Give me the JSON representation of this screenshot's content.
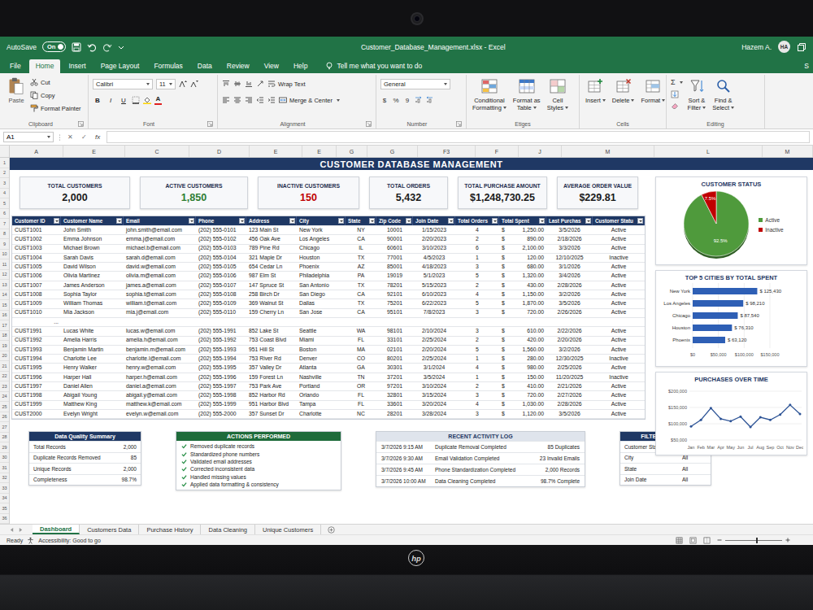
{
  "window": {
    "autosave_label": "AutoSave",
    "autosave": {
      "on": true,
      "text": "On"
    },
    "title": "Customer_Database_Management.xlsx - Excel",
    "user": "Hazem A.",
    "initials": "HA"
  },
  "ribbon_tabs": [
    {
      "label": "File",
      "selected": false
    },
    {
      "label": "Home",
      "selected": true
    },
    {
      "label": "Insert",
      "selected": false
    },
    {
      "label": "Page Layout",
      "selected": false
    },
    {
      "label": "Formulas",
      "selected": false
    },
    {
      "label": "Data",
      "selected": false
    },
    {
      "label": "Review",
      "selected": false
    },
    {
      "label": "View",
      "selected": false
    },
    {
      "label": "Help",
      "selected": false
    }
  ],
  "tell_me": "Tell me what you want to do",
  "share": "S",
  "ribbon": {
    "clipboard": {
      "label": "Clipboard",
      "paste": "Paste",
      "items": [
        "Cut",
        "Copy",
        "Format Painter"
      ]
    },
    "font": {
      "label": "Font",
      "family": "Calibri",
      "size": "11",
      "styles": [
        "B",
        "I",
        "U"
      ],
      "color_glyph": "A"
    },
    "alignment": {
      "label": "Alignment",
      "wrap": "Wrap Text",
      "merge": "Merge & Center"
    },
    "number": {
      "label": "Number",
      "format": "General",
      "symbols": [
        "$",
        "%",
        "9"
      ]
    },
    "styles": {
      "label": "Etiges",
      "buttons": [
        {
          "lines": [
            "Conditional",
            "Formatting"
          ]
        },
        {
          "lines": [
            "Format as",
            "Table"
          ]
        },
        {
          "lines": [
            "Cell",
            "Styles"
          ]
        }
      ]
    },
    "cells": {
      "label": "Cells",
      "buttons": [
        "Insert",
        "Delete",
        "Format"
      ]
    },
    "editing": {
      "label": "Editing",
      "autosum": "Σ",
      "buttons": [
        {
          "lines": [
            "Sort &",
            "Filter"
          ]
        },
        {
          "lines": [
            "Find &",
            "Select"
          ]
        }
      ]
    }
  },
  "formula_bar": {
    "name_box": "A1",
    "cancel": "✕",
    "enter": "✓",
    "fx": "fx"
  },
  "sheet": {
    "columns": [
      "A",
      "E",
      "C",
      "D",
      "E",
      "E",
      "G",
      "G",
      "F3",
      "F",
      "J",
      "M",
      "L",
      "M"
    ],
    "row_numbers": [
      "1",
      "2",
      "3",
      "4",
      "5",
      "6",
      "7",
      "8",
      "9",
      "10",
      "11",
      "12",
      "13",
      "14",
      "15",
      "16",
      "17",
      "18",
      "19",
      "20",
      "21",
      "22",
      "23",
      "24",
      "25",
      "26",
      "27",
      "28",
      "29",
      "30",
      "31",
      "32",
      "33",
      "34",
      "35",
      "36"
    ]
  },
  "dashboard": {
    "title": "CUSTOMER DATABASE MANAGEMENT",
    "kpis": [
      {
        "label": "TOTAL CUSTOMERS",
        "value": "2,000",
        "color": "#1a1a1a"
      },
      {
        "label": "ACTIVE CUSTOMERS",
        "value": "1,850",
        "color": "#2e7d32"
      },
      {
        "label": "INACTIVE CUSTOMERS",
        "value": "150",
        "color": "#c00000"
      },
      {
        "label": "TOTAL ORDERS",
        "value": "5,432",
        "color": "#1a1a1a"
      },
      {
        "label": "TOTAL PURCHASE AMOUNT",
        "value": "$1,248,730.25",
        "color": "#1a1a1a"
      },
      {
        "label": "AVERAGE ORDER VALUE",
        "value": "$229.81",
        "color": "#1a1a1a"
      }
    ],
    "table": {
      "columns": [
        "Customer ID",
        "Customer Name",
        "Email",
        "Phone",
        "Address",
        "City",
        "State",
        "Zip Code",
        "Join Date",
        "Total Orders",
        "Total Spent",
        "Last Purchas",
        "Customer Statu"
      ],
      "rows_top": [
        [
          "CUST1001",
          "John Smith",
          "john.smith@email.com",
          "(202) 555-0101",
          "123 Main St",
          "New York",
          "NY",
          "10001",
          "1/15/2023",
          "4",
          "$",
          "1,250.00",
          "3/5/2026",
          "Active"
        ],
        [
          "CUST1002",
          "Emma Johnson",
          "emma.j@email.com",
          "(202) 555-0102",
          "456 Oak Ave",
          "Los Angeles",
          "CA",
          "90001",
          "2/20/2023",
          "2",
          "$",
          "890.00",
          "2/18/2026",
          "Active"
        ],
        [
          "CUST1003",
          "Michael Brown",
          "michael.b@email.com",
          "(202) 555-0103",
          "789 Pine Rd",
          "Chicago",
          "IL",
          "60601",
          "3/10/2023",
          "6",
          "$",
          "2,100.00",
          "3/3/2026",
          "Active"
        ],
        [
          "CUST1004",
          "Sarah Davis",
          "sarah.d@email.com",
          "(202) 555-0104",
          "321 Maple Dr",
          "Houston",
          "TX",
          "77001",
          "4/5/2023",
          "1",
          "$",
          "120.00",
          "12/10/2025",
          "Inactive"
        ],
        [
          "CUST1005",
          "David Wilson",
          "david.w@email.com",
          "(202) 555-0105",
          "654 Cedar Ln",
          "Phoenix",
          "AZ",
          "85001",
          "4/18/2023",
          "3",
          "$",
          "680.00",
          "3/1/2026",
          "Active"
        ],
        [
          "CUST1006",
          "Olivia Martinez",
          "olivia.m@email.com",
          "(202) 555-0106",
          "987 Elm St",
          "Philadelphia",
          "PA",
          "19019",
          "5/1/2023",
          "5",
          "$",
          "1,320.00",
          "3/4/2026",
          "Active"
        ],
        [
          "CUST1007",
          "James Anderson",
          "james.a@email.com",
          "(202) 555-0107",
          "147 Spruce St",
          "San Antonio",
          "TX",
          "78201",
          "5/15/2023",
          "2",
          "$",
          "430.00",
          "2/28/2026",
          "Active"
        ],
        [
          "CUST1008",
          "Sophia Taylor",
          "sophia.t@email.com",
          "(202) 555-0108",
          "258 Birch Dr",
          "San Diego",
          "CA",
          "92101",
          "6/10/2023",
          "4",
          "$",
          "1,150.00",
          "3/2/2026",
          "Active"
        ],
        [
          "CUST1009",
          "William Thomas",
          "william.t@email.com",
          "(202) 555-0109",
          "369 Walnut St",
          "Dallas",
          "TX",
          "75201",
          "6/22/2023",
          "5",
          "$",
          "1,870.00",
          "3/5/2026",
          "Active"
        ],
        [
          "CUST1010",
          "Mia Jackson",
          "mia.j@email.com",
          "(202) 555-0110",
          "159 Cherry Ln",
          "San Jose",
          "CA",
          "95101",
          "7/8/2023",
          "3",
          "$",
          "720.00",
          "2/26/2026",
          "Active"
        ]
      ],
      "gap_marker": "...",
      "rows_bottom": [
        [
          "CUST1991",
          "Lucas White",
          "lucas.w@email.com",
          "(202) 555-1991",
          "852 Lake St",
          "Seattle",
          "WA",
          "98101",
          "2/10/2024",
          "3",
          "$",
          "610.00",
          "2/22/2026",
          "Active"
        ],
        [
          "CUST1992",
          "Amelia Harris",
          "amelia.h@email.com",
          "(202) 555-1992",
          "753 Coast Blvd",
          "Miami",
          "FL",
          "33101",
          "2/25/2024",
          "2",
          "$",
          "420.00",
          "2/20/2026",
          "Active"
        ],
        [
          "CUST1993",
          "Benjamin Martin",
          "benjamin.m@email.com",
          "(202) 555-1993",
          "951 Hill St",
          "Boston",
          "MA",
          "02101",
          "2/20/2024",
          "5",
          "$",
          "1,560.00",
          "3/2/2026",
          "Active"
        ],
        [
          "CUST1994",
          "Charlotte Lee",
          "charlotte.l@email.com",
          "(202) 555-1994",
          "753 River Rd",
          "Denver",
          "CO",
          "80201",
          "2/25/2024",
          "1",
          "$",
          "280.00",
          "12/30/2025",
          "Inactive"
        ],
        [
          "CUST1995",
          "Henry Walker",
          "henry.w@email.com",
          "(202) 555-1995",
          "357 Valley Dr",
          "Atlanta",
          "GA",
          "30301",
          "3/1/2024",
          "4",
          "$",
          "980.00",
          "2/25/2026",
          "Active"
        ],
        [
          "CUST1996",
          "Harper Hall",
          "harper.h@email.com",
          "(202) 555-1996",
          "159 Forest Ln",
          "Nashville",
          "TN",
          "37201",
          "3/5/2024",
          "1",
          "$",
          "150.00",
          "11/20/2025",
          "Inactive"
        ],
        [
          "CUST1997",
          "Daniel Allen",
          "daniel.a@email.com",
          "(202) 555-1997",
          "753 Park Ave",
          "Portland",
          "OR",
          "97201",
          "3/10/2024",
          "2",
          "$",
          "410.00",
          "2/21/2026",
          "Active"
        ],
        [
          "CUST1998",
          "Abigail Young",
          "abigail.y@email.com",
          "(202) 555-1998",
          "852 Harbor Rd",
          "Orlando",
          "FL",
          "32801",
          "3/15/2024",
          "3",
          "$",
          "720.00",
          "2/27/2026",
          "Active"
        ],
        [
          "CUST1999",
          "Matthew King",
          "matthew.k@email.com",
          "(202) 555-1999",
          "951 Harbor Blvd",
          "Tampa",
          "FL",
          "33601",
          "3/20/2024",
          "4",
          "$",
          "1,030.00",
          "2/28/2026",
          "Active"
        ],
        [
          "CUST2000",
          "Evelyn Wright",
          "evelyn.w@email.com",
          "(202) 555-2000",
          "357 Sunset Dr",
          "Charlotte",
          "NC",
          "28201",
          "3/28/2024",
          "3",
          "$",
          "1,120.00",
          "3/5/2026",
          "Active"
        ]
      ]
    },
    "status_chart": {
      "title": "CUSTOMER STATUS",
      "slices": [
        {
          "label": "Active",
          "value": 92.5,
          "reading": "92.5%",
          "color": "#4f9a3c"
        },
        {
          "label": "Inactive",
          "value": 7.5,
          "reading": "7.5%",
          "color": "#c00000"
        }
      ]
    },
    "city_chart": {
      "title": "TOP 5 CITIES BY TOTAL SPENT",
      "axis_max": 150000,
      "bars": [
        {
          "label": "New York",
          "value": 125430,
          "reading": "$ 125,430"
        },
        {
          "label": "Los Angeles",
          "value": 98210,
          "reading": "$ 98,210"
        },
        {
          "label": "Chicago",
          "value": 87540,
          "reading": "$ 87,540"
        },
        {
          "label": "Houston",
          "value": 76310,
          "reading": "$ 76,310"
        },
        {
          "label": "Phoenix",
          "value": 63120,
          "reading": "$ 63,120"
        }
      ],
      "ticks": [
        "$0",
        "$50,000",
        "$100,000",
        "$150,000"
      ]
    },
    "time_chart": {
      "title": "PURCHASES OVER TIME",
      "axis_min": 50000,
      "axis_max": 200000,
      "y_ticks": [
        "$200,000",
        "$150,000",
        "$100,000",
        "$50,000"
      ],
      "months": [
        "Jan",
        "Feb",
        "Mar",
        "Apr",
        "May",
        "Jun",
        "Jul",
        "Aug",
        "Sep",
        "Oct",
        "Nov",
        "Dec"
      ],
      "values": [
        92000,
        112000,
        148000,
        115000,
        108000,
        122000,
        90000,
        120000,
        112000,
        128000,
        158000,
        130000
      ]
    },
    "quality": {
      "title": "Data Quality Summary",
      "rows": [
        {
          "label": "Total Records",
          "value": "2,000"
        },
        {
          "label": "Duplicate Records Removed",
          "value": "85"
        },
        {
          "label": "Unique Records",
          "value": "2,000"
        },
        {
          "label": "Completeness",
          "value": "98.7%"
        }
      ]
    },
    "actions": {
      "title": "ACTIONS PERFORMED",
      "items": [
        "Removed duplicate records",
        "Standardized phone numbers",
        "Validated email addresses",
        "Corrected inconsistent data",
        "Handled missing values",
        "Applied data formatting & consistency"
      ]
    },
    "activity": {
      "title": "RECENT ACTIVITY LOG",
      "rows": [
        {
          "time": "3/7/2026 9:15 AM",
          "event": "Duplicate Removal Completed",
          "result": "85 Duplicates"
        },
        {
          "time": "3/7/2026 9:30 AM",
          "event": "Email Validation Completed",
          "result": "23 Invalid Emails"
        },
        {
          "time": "3/7/2026 9:45 AM",
          "event": "Phone Standardization Completed",
          "result": "2,000 Records"
        },
        {
          "time": "3/7/2026 10:00 AM",
          "event": "Data Cleaning Completed",
          "result": "98.7% Complete"
        }
      ]
    },
    "filters": {
      "title": "FILTERS APPLIED",
      "rows": [
        {
          "label": "Customer Status",
          "value": "All"
        },
        {
          "label": "City",
          "value": "All"
        },
        {
          "label": "State",
          "value": "All"
        },
        {
          "label": "Join Date",
          "value": "All"
        }
      ]
    }
  },
  "sheet_tabs": [
    {
      "label": "Dashboard",
      "selected": true
    },
    {
      "label": "Customers Data",
      "selected": false
    },
    {
      "label": "Purchase History",
      "selected": false
    },
    {
      "label": "Data Cleaning",
      "selected": false
    },
    {
      "label": "Unique Customers",
      "selected": false
    }
  ],
  "status_bar": {
    "ready": "Ready",
    "accessibility": "Accessibility: Good to go",
    "zoom": {
      "level": 0.55
    }
  },
  "laptop": {
    "logo": "hp"
  }
}
